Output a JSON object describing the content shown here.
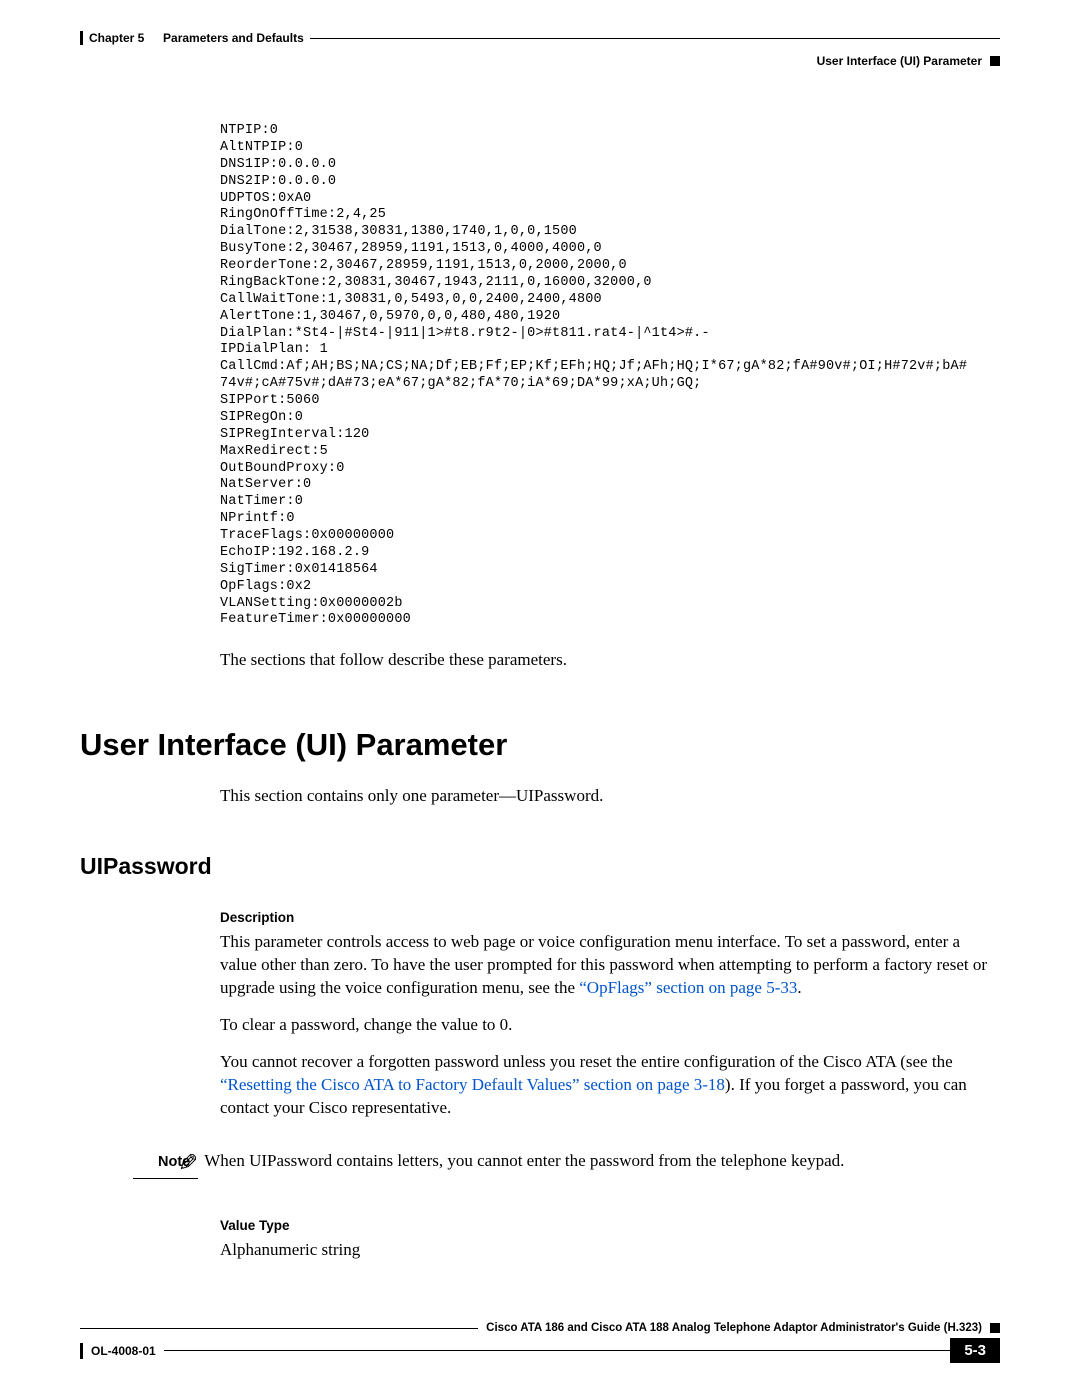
{
  "header": {
    "chapter": "Chapter 5",
    "chapter_title": "Parameters and Defaults",
    "section_running": "User Interface (UI) Parameter"
  },
  "code_block": "NTPIP:0\nAltNTPIP:0\nDNS1IP:0.0.0.0\nDNS2IP:0.0.0.0\nUDPTOS:0xA0\nRingOnOffTime:2,4,25\nDialTone:2,31538,30831,1380,1740,1,0,0,1500\nBusyTone:2,30467,28959,1191,1513,0,4000,4000,0\nReorderTone:2,30467,28959,1191,1513,0,2000,2000,0\nRingBackTone:2,30831,30467,1943,2111,0,16000,32000,0\nCallWaitTone:1,30831,0,5493,0,0,2400,2400,4800\nAlertTone:1,30467,0,5970,0,0,480,480,1920\nDialPlan:*St4-|#St4-|911|1>#t8.r9t2-|0>#t811.rat4-|^1t4>#.-\nIPDialPlan: 1\nCallCmd:Af;AH;BS;NA;CS;NA;Df;EB;Ff;EP;Kf;EFh;HQ;Jf;AFh;HQ;I*67;gA*82;fA#90v#;OI;H#72v#;bA#\n74v#;cA#75v#;dA#73;eA*67;gA*82;fA*70;iA*69;DA*99;xA;Uh;GQ;\nSIPPort:5060\nSIPRegOn:0\nSIPRegInterval:120\nMaxRedirect:5\nOutBoundProxy:0\nNatServer:0\nNatTimer:0\nNPrintf:0\nTraceFlags:0x00000000\nEchoIP:192.168.2.9\nSigTimer:0x01418564\nOpFlags:0x2\nVLANSetting:0x0000002b\nFeatureTimer:0x00000000",
  "intro_after_code": "The sections that follow describe these parameters.",
  "section": {
    "title": "User Interface (UI) Parameter",
    "intro": "This section contains only one parameter—UIPassword."
  },
  "uipassword": {
    "title": "UIPassword",
    "desc_label": "Description",
    "desc_p1_a": "This parameter controls access to web page or voice configuration menu interface. To set a password, enter a value other than zero. To have the user prompted for this password when attempting to perform a factory reset or upgrade using the voice configuration menu, see the ",
    "desc_p1_link": "“OpFlags” section on page 5-33",
    "desc_p1_b": ".",
    "desc_p2": "To clear a password, change the value to 0.",
    "desc_p3_a": "You cannot recover a forgotten password unless you reset the entire configuration of the Cisco ATA (see the ",
    "desc_p3_link": "“Resetting the Cisco ATA to Factory Default Values” section on page 3-18",
    "desc_p3_b": "). If you forget a password, you can contact your Cisco representative.",
    "note_label": "Note",
    "note_text": "When UIPassword contains letters, you cannot enter the password from the telephone keypad.",
    "value_type_label": "Value Type",
    "value_type": "Alphanumeric string"
  },
  "footer": {
    "guide": "Cisco ATA 186 and Cisco ATA 188 Analog Telephone Adaptor Administrator's Guide (H.323)",
    "doc_id": "OL-4008-01",
    "page": "5-3"
  }
}
